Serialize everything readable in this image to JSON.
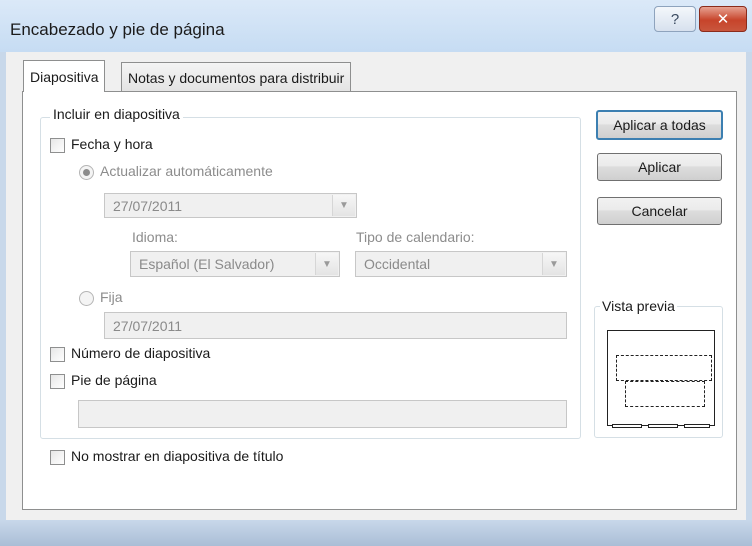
{
  "window": {
    "title": "Encabezado y pie de página",
    "help_glyph": "?",
    "close_glyph": "✕"
  },
  "tabs": [
    {
      "label": "Diapositiva",
      "active": true
    },
    {
      "label": "Notas y documentos para distribuir",
      "active": false
    }
  ],
  "include": {
    "group_label": "Incluir en diapositiva",
    "date_time": {
      "label": "Fecha y hora",
      "checked": false
    },
    "auto_update": {
      "label": "Actualizar automáticamente",
      "selected": true
    },
    "auto_date_value": "27/07/2011",
    "language": {
      "label": "Idioma:",
      "value": "Español (El Salvador)"
    },
    "calendar": {
      "label": "Tipo de calendario:",
      "value": "Occidental"
    },
    "fixed": {
      "label": "Fija",
      "selected": false
    },
    "fixed_date_value": "27/07/2011",
    "slide_number": {
      "label": "Número de diapositiva",
      "checked": false
    },
    "footer": {
      "label": "Pie de página",
      "checked": false,
      "value": ""
    }
  },
  "hide_on_title": {
    "label": "No mostrar en diapositiva de título",
    "checked": false
  },
  "buttons": {
    "apply_all": "Aplicar a todas",
    "apply": "Aplicar",
    "cancel": "Cancelar"
  },
  "preview": {
    "label": "Vista previa"
  }
}
